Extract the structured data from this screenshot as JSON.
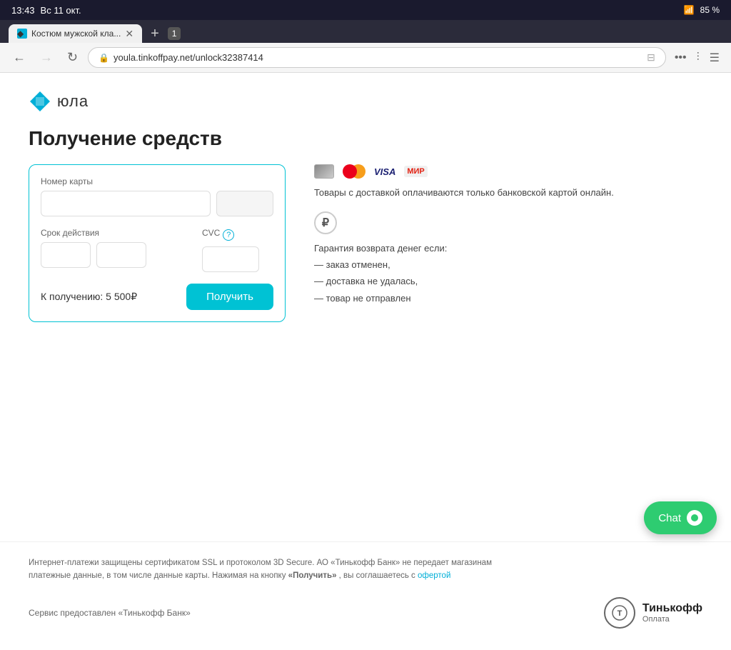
{
  "statusBar": {
    "time": "13:43",
    "date": "Вс 11 окт.",
    "wifi": "WiFi",
    "battery": "85 %"
  },
  "browser": {
    "tab": {
      "title": "Костюм мужской кла...",
      "favicon": "◆"
    },
    "url": "youla.tinkoffpay.net/unlock32387414",
    "backBtn": "←",
    "forwardBtn": "→",
    "refreshBtn": "↻",
    "tabCount": "1"
  },
  "page": {
    "logo": {
      "text": "юла",
      "diamond": "◆"
    },
    "title": "Получение средств",
    "form": {
      "cardNumberLabel": "Номер карты",
      "cardNumberPlaceholder": "",
      "expiryLabel": "Срок действия",
      "expiryMonth": "",
      "expiryYear": "",
      "cvcLabel": "CVC",
      "cvcPlaceholder": "",
      "amountLabel": "К получению: 5 500₽",
      "submitButton": "Получить"
    },
    "infoPanel": {
      "bankCardText": "Товары с доставкой оплачиваются только банковской картой онлайн.",
      "guaranteeTitle": "Гарантия возврата денег если:",
      "guaranteeItems": [
        "— заказ отменен,",
        "— доставка не удалась,",
        "— товар не отправлен"
      ]
    },
    "footer": {
      "securityText": "Интернет-платежи защищены сертификатом SSL и протоколом 3D Secure. АО «Тинькофф Банк» не передает магазинам платежные данные, в том числе данные карты. Нажимая на кнопку",
      "buttonRef": "«Получить»",
      "agreementText": ", вы соглашаетесь с",
      "ofertaLink": "офертой",
      "serviceText": "Сервис предоставлен «Тинькофф Банк»",
      "tinkoffName": "Тинькофф",
      "tinkoffSub": "Оплата"
    },
    "chat": {
      "label": "Chat"
    }
  }
}
